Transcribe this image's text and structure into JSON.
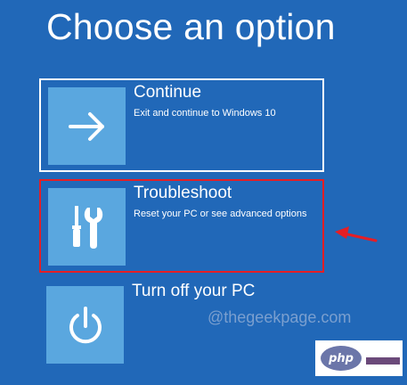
{
  "title": "Choose an option",
  "options": [
    {
      "title": "Continue",
      "description": "Exit and continue to Windows 10",
      "icon": "arrow-right-icon",
      "state": "selected"
    },
    {
      "title": "Troubleshoot",
      "description": "Reset your PC or see advanced options",
      "icon": "tools-icon",
      "state": "highlighted"
    },
    {
      "title": "Turn off your PC",
      "description": "",
      "icon": "power-icon",
      "state": "normal"
    }
  ],
  "annotation": {
    "type": "arrow",
    "color": "#e51e25",
    "points_to": "Troubleshoot"
  },
  "watermark": "@thegeekpage.com",
  "logo": {
    "text": "php"
  },
  "colors": {
    "background": "#2168b8",
    "tile": "#5aa7df",
    "highlight_border": "#e51e25",
    "selected_border": "#ffffff"
  }
}
